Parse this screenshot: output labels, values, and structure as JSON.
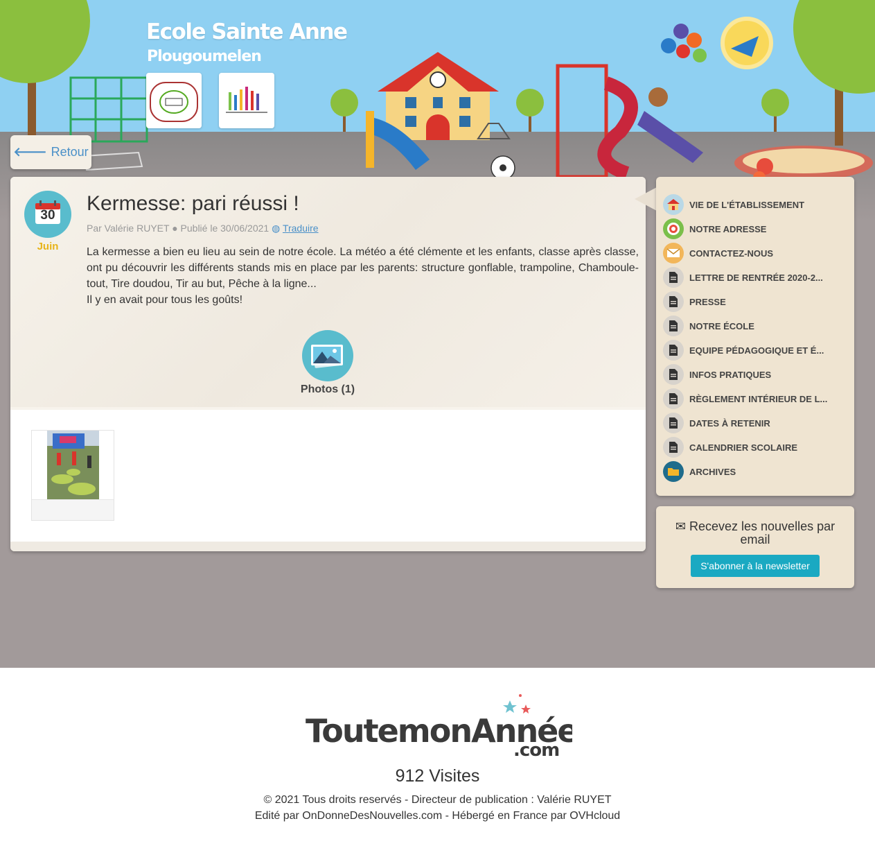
{
  "header": {
    "school_name": "Ecole Sainte Anne",
    "town": "Plougoumelen",
    "logos": [
      "ecole-sainte-anne-logo",
      "diocese-logo"
    ],
    "back_label": "Retour"
  },
  "article": {
    "date_day": "30",
    "date_month": "Juin",
    "title": "Kermesse: pari réussi !",
    "meta": "Par Valérie RUYET ● Publié le 30/06/2021",
    "translate_label": "Traduire",
    "body_paragraph_1": "La kermesse a bien eu lieu au sein de notre école. La météo a été clémente et les enfants, classe après classe, ont pu découvrir les différents stands mis en place par les parents: structure gonflable, trampoline, Chamboule-tout, Tire doudou, Tir au but, Pêche à la ligne...",
    "body_paragraph_2": "Il y en avait pour tous les goûts!",
    "photos_label": "Photos (1)"
  },
  "sidebar": {
    "items": [
      {
        "label": "VIE DE L'ÉTABLISSEMENT",
        "icon": "school-icon",
        "color": "#b9d8e6"
      },
      {
        "label": "NOTRE ADRESSE",
        "icon": "target-icon",
        "color": "#7bbf4a"
      },
      {
        "label": "CONTACTEZ-NOUS",
        "icon": "envelope-icon",
        "color": "#f2b65a"
      },
      {
        "label": "LETTRE DE RENTRÉE 2020-2...",
        "icon": "document-icon",
        "color": "#d8d3cc"
      },
      {
        "label": "PRESSE",
        "icon": "document-icon",
        "color": "#d8d3cc"
      },
      {
        "label": "NOTRE ÉCOLE",
        "icon": "document-icon",
        "color": "#d8d3cc"
      },
      {
        "label": "EQUIPE PÉDAGOGIQUE ET É...",
        "icon": "document-icon",
        "color": "#d8d3cc"
      },
      {
        "label": "INFOS PRATIQUES",
        "icon": "document-icon",
        "color": "#d8d3cc"
      },
      {
        "label": "RÈGLEMENT INTÉRIEUR DE L...",
        "icon": "document-icon",
        "color": "#d8d3cc"
      },
      {
        "label": "DATES À RETENIR",
        "icon": "document-icon",
        "color": "#d8d3cc"
      },
      {
        "label": "CALENDRIER SCOLAIRE",
        "icon": "document-icon",
        "color": "#d8d3cc"
      },
      {
        "label": "ARCHIVES",
        "icon": "folder-icon",
        "color": "#1f6c8c"
      }
    ]
  },
  "newsletter": {
    "title": "Recevez les nouvelles par email",
    "button_label": "S'abonner à la newsletter"
  },
  "footer": {
    "brand_logo_text": "ToutemonAnnée.com",
    "visits": "912 Visites",
    "copyright": "© 2021 Tous droits reservés - Directeur de publication : Valérie RUYET",
    "edited_by": "Edité par OnDonneDesNouvelles.com - Hébergé en France par OVHcloud"
  },
  "colors": {
    "sky": "#8fd0f2",
    "ground": "#a29a9a",
    "accent_blue": "#4a90c8",
    "newsletter_button": "#1aa9c2",
    "date_badge": "#59bccd",
    "month_text": "#e7b418"
  }
}
